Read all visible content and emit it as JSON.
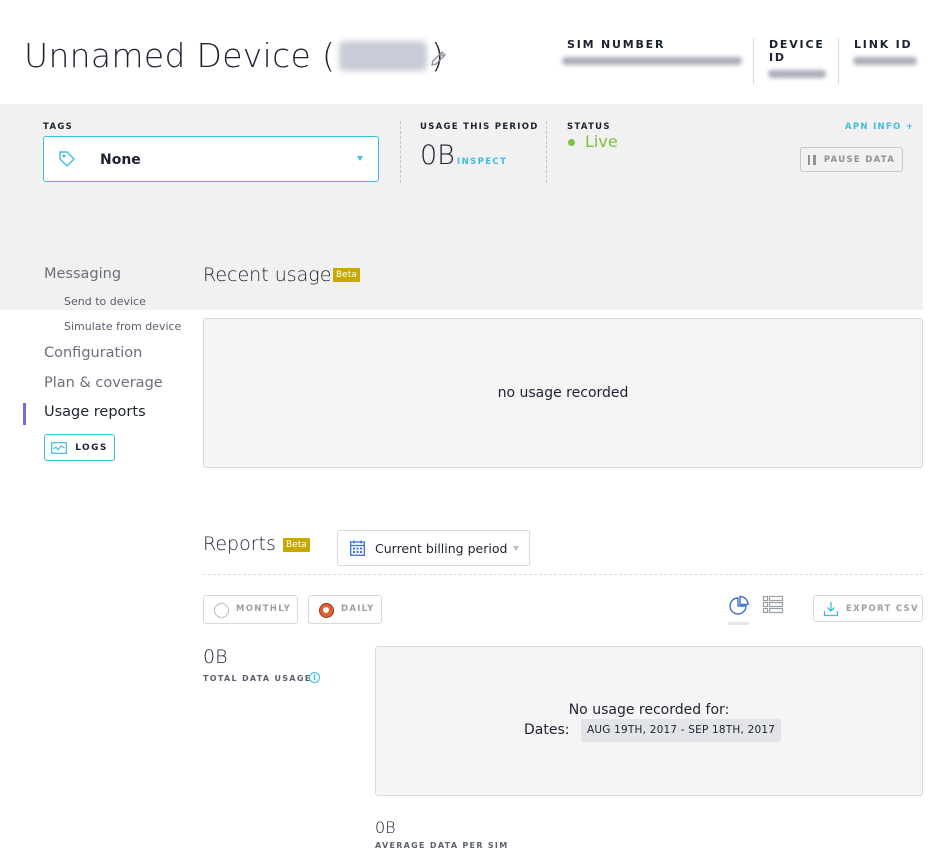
{
  "header": {
    "title_prefix": "Unnamed Device (",
    "title_suffix": ")",
    "sim_number_label": "SIM NUMBER",
    "device_id_label_1": "DEVICE",
    "device_id_label_2": "ID",
    "link_id_label": "LINK ID"
  },
  "info": {
    "tags_label": "TAGS",
    "tags_value": "None",
    "usage_label": "USAGE THIS PERIOD",
    "usage_value": "0B",
    "inspect_label": "INSPECT",
    "status_label": "STATUS",
    "status_value": "Live",
    "apn_label": "APN INFO +",
    "pause_label": "PAUSE DATA"
  },
  "sidebar": {
    "items": [
      {
        "label": "Messaging"
      },
      {
        "label": "Send to device"
      },
      {
        "label": "Simulate from device"
      },
      {
        "label": "Configuration"
      },
      {
        "label": "Plan & coverage"
      },
      {
        "label": "Usage reports"
      }
    ],
    "logs_label": "LOGS"
  },
  "recent": {
    "title": "Recent usage",
    "beta": "Beta",
    "empty_msg": "no usage recorded"
  },
  "reports": {
    "title": "Reports",
    "beta": "Beta",
    "period_value": "Current billing period",
    "monthly_label": "MONTHLY",
    "daily_label": "DAILY",
    "selected": "daily",
    "export_label": "EXPORT CSV",
    "total_value": "0B",
    "total_label": "TOTAL DATA USAGE",
    "no_usage_msg": "No usage recorded for:",
    "dates_label": "Dates:",
    "dates_value": "AUG 19TH, 2017 - SEP 18TH, 2017",
    "avg_value": "0B",
    "avg_label": "AVERAGE DATA PER SIM"
  },
  "colors": {
    "accent": "#3dbde0",
    "live": "#7ec13a",
    "beta": "#c8a900",
    "active_bar": "#7a68e0"
  }
}
